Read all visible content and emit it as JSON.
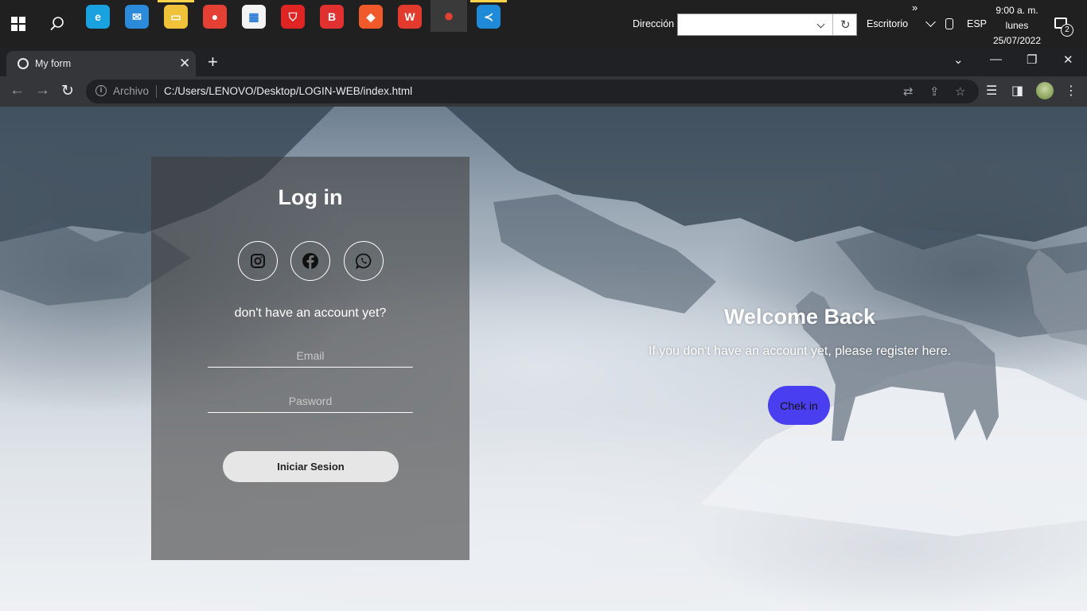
{
  "taskbar": {
    "address_label": "Dirección",
    "desktop_label": "Escritorio",
    "overflow_glyph": "»",
    "language": "ESP",
    "clock": {
      "time": "9:00 a. m.",
      "day": "lunes",
      "date": "25/07/2022"
    },
    "notifications_count": "2",
    "apps": [
      {
        "icon": "edge-icon",
        "color": "#1aa1e0"
      },
      {
        "icon": "mail-icon",
        "color": "#2b8ad9"
      },
      {
        "icon": "file-explorer-icon",
        "color": "#f0c23a"
      },
      {
        "icon": "chrome-icon",
        "color": "#e44134"
      },
      {
        "icon": "microsoft-store-icon",
        "color": "#f3f3f3"
      },
      {
        "icon": "brave-shield-icon",
        "color": "#e02424"
      },
      {
        "icon": "b-app-icon",
        "color": "#e0302f"
      },
      {
        "icon": "brave-icon",
        "color": "#f05a2b"
      },
      {
        "icon": "wps-office-icon",
        "color": "#e23a2c"
      },
      {
        "icon": "chrome-active-icon",
        "color": "#3a3a3a"
      },
      {
        "icon": "vscode-icon",
        "color": "#1f8ad8"
      }
    ]
  },
  "browser": {
    "tab_title": "My form",
    "url_scheme": "Archivo",
    "url": "C:/Users/LENOVO/Desktop/LOGIN-WEB/index.html"
  },
  "login": {
    "title": "Log in",
    "social_icons": [
      "instagram-icon",
      "facebook-icon",
      "whatsapp-icon"
    ],
    "subtitle": "don't have an account yet?",
    "email_placeholder": "Email",
    "password_placeholder": "Pasword",
    "submit_label": "Iniciar Sesion"
  },
  "welcome": {
    "title": "Welcome Back",
    "subtitle": "If you don't have an account yet, please register here.",
    "button_label": "Chek in"
  },
  "colors": {
    "accent_button": "#4a3ff0",
    "card_overlay": "rgba(60,60,60,0.6)"
  }
}
